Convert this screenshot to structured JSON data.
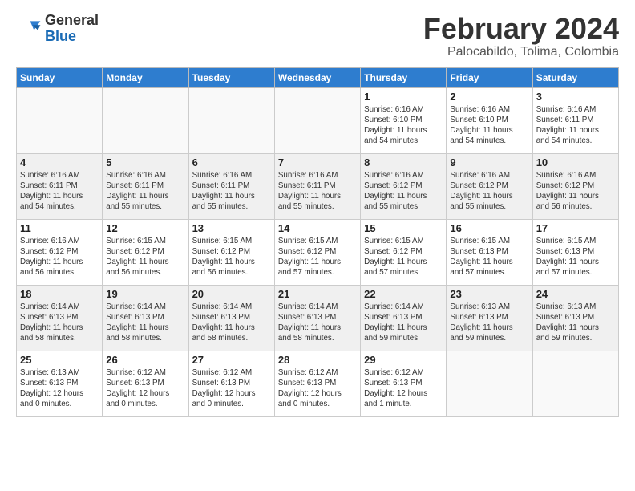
{
  "logo": {
    "general": "General",
    "blue": "Blue"
  },
  "header": {
    "title": "February 2024",
    "subtitle": "Palocabildo, Tolima, Colombia"
  },
  "weekdays": [
    "Sunday",
    "Monday",
    "Tuesday",
    "Wednesday",
    "Thursday",
    "Friday",
    "Saturday"
  ],
  "weeks": [
    [
      {
        "day": "",
        "info": ""
      },
      {
        "day": "",
        "info": ""
      },
      {
        "day": "",
        "info": ""
      },
      {
        "day": "",
        "info": ""
      },
      {
        "day": "1",
        "info": "Sunrise: 6:16 AM\nSunset: 6:10 PM\nDaylight: 11 hours\nand 54 minutes."
      },
      {
        "day": "2",
        "info": "Sunrise: 6:16 AM\nSunset: 6:10 PM\nDaylight: 11 hours\nand 54 minutes."
      },
      {
        "day": "3",
        "info": "Sunrise: 6:16 AM\nSunset: 6:11 PM\nDaylight: 11 hours\nand 54 minutes."
      }
    ],
    [
      {
        "day": "4",
        "info": "Sunrise: 6:16 AM\nSunset: 6:11 PM\nDaylight: 11 hours\nand 54 minutes."
      },
      {
        "day": "5",
        "info": "Sunrise: 6:16 AM\nSunset: 6:11 PM\nDaylight: 11 hours\nand 55 minutes."
      },
      {
        "day": "6",
        "info": "Sunrise: 6:16 AM\nSunset: 6:11 PM\nDaylight: 11 hours\nand 55 minutes."
      },
      {
        "day": "7",
        "info": "Sunrise: 6:16 AM\nSunset: 6:11 PM\nDaylight: 11 hours\nand 55 minutes."
      },
      {
        "day": "8",
        "info": "Sunrise: 6:16 AM\nSunset: 6:12 PM\nDaylight: 11 hours\nand 55 minutes."
      },
      {
        "day": "9",
        "info": "Sunrise: 6:16 AM\nSunset: 6:12 PM\nDaylight: 11 hours\nand 55 minutes."
      },
      {
        "day": "10",
        "info": "Sunrise: 6:16 AM\nSunset: 6:12 PM\nDaylight: 11 hours\nand 56 minutes."
      }
    ],
    [
      {
        "day": "11",
        "info": "Sunrise: 6:16 AM\nSunset: 6:12 PM\nDaylight: 11 hours\nand 56 minutes."
      },
      {
        "day": "12",
        "info": "Sunrise: 6:15 AM\nSunset: 6:12 PM\nDaylight: 11 hours\nand 56 minutes."
      },
      {
        "day": "13",
        "info": "Sunrise: 6:15 AM\nSunset: 6:12 PM\nDaylight: 11 hours\nand 56 minutes."
      },
      {
        "day": "14",
        "info": "Sunrise: 6:15 AM\nSunset: 6:12 PM\nDaylight: 11 hours\nand 57 minutes."
      },
      {
        "day": "15",
        "info": "Sunrise: 6:15 AM\nSunset: 6:12 PM\nDaylight: 11 hours\nand 57 minutes."
      },
      {
        "day": "16",
        "info": "Sunrise: 6:15 AM\nSunset: 6:13 PM\nDaylight: 11 hours\nand 57 minutes."
      },
      {
        "day": "17",
        "info": "Sunrise: 6:15 AM\nSunset: 6:13 PM\nDaylight: 11 hours\nand 57 minutes."
      }
    ],
    [
      {
        "day": "18",
        "info": "Sunrise: 6:14 AM\nSunset: 6:13 PM\nDaylight: 11 hours\nand 58 minutes."
      },
      {
        "day": "19",
        "info": "Sunrise: 6:14 AM\nSunset: 6:13 PM\nDaylight: 11 hours\nand 58 minutes."
      },
      {
        "day": "20",
        "info": "Sunrise: 6:14 AM\nSunset: 6:13 PM\nDaylight: 11 hours\nand 58 minutes."
      },
      {
        "day": "21",
        "info": "Sunrise: 6:14 AM\nSunset: 6:13 PM\nDaylight: 11 hours\nand 58 minutes."
      },
      {
        "day": "22",
        "info": "Sunrise: 6:14 AM\nSunset: 6:13 PM\nDaylight: 11 hours\nand 59 minutes."
      },
      {
        "day": "23",
        "info": "Sunrise: 6:13 AM\nSunset: 6:13 PM\nDaylight: 11 hours\nand 59 minutes."
      },
      {
        "day": "24",
        "info": "Sunrise: 6:13 AM\nSunset: 6:13 PM\nDaylight: 11 hours\nand 59 minutes."
      }
    ],
    [
      {
        "day": "25",
        "info": "Sunrise: 6:13 AM\nSunset: 6:13 PM\nDaylight: 12 hours\nand 0 minutes."
      },
      {
        "day": "26",
        "info": "Sunrise: 6:12 AM\nSunset: 6:13 PM\nDaylight: 12 hours\nand 0 minutes."
      },
      {
        "day": "27",
        "info": "Sunrise: 6:12 AM\nSunset: 6:13 PM\nDaylight: 12 hours\nand 0 minutes."
      },
      {
        "day": "28",
        "info": "Sunrise: 6:12 AM\nSunset: 6:13 PM\nDaylight: 12 hours\nand 0 minutes."
      },
      {
        "day": "29",
        "info": "Sunrise: 6:12 AM\nSunset: 6:13 PM\nDaylight: 12 hours\nand 1 minute."
      },
      {
        "day": "",
        "info": ""
      },
      {
        "day": "",
        "info": ""
      }
    ]
  ]
}
